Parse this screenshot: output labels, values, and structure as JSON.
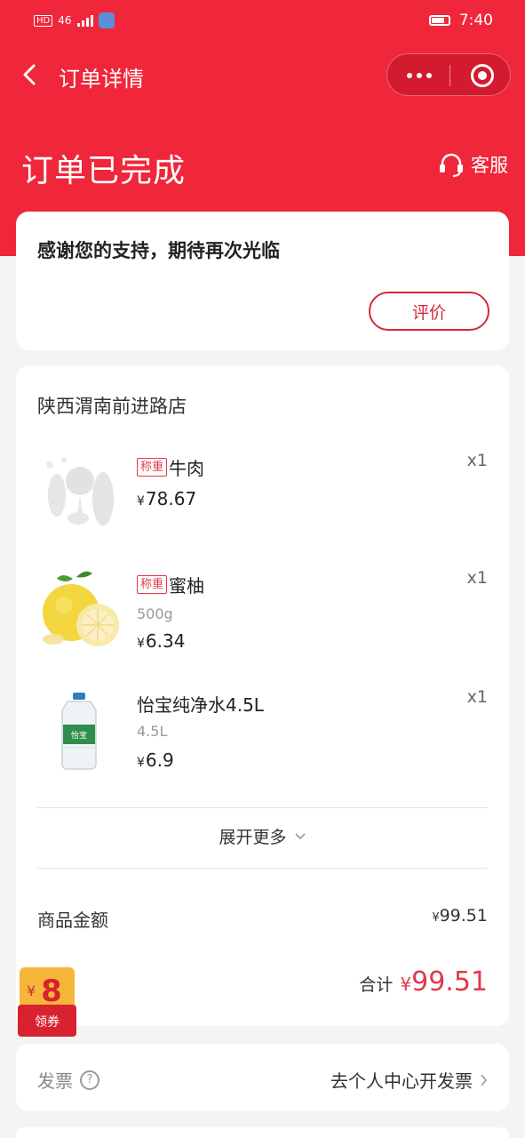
{
  "status_bar": {
    "time": "7:40",
    "network": "46",
    "battery_level": ""
  },
  "nav": {
    "title": "订单详情"
  },
  "order": {
    "status": "订单已完成",
    "service_label": "客服"
  },
  "thanks": {
    "message": "感谢您的支持，期待再次光临",
    "review_button": "评价"
  },
  "store": {
    "name": "陕西渭南前进路店"
  },
  "items": [
    {
      "tag": "称重",
      "name": "牛肉",
      "spec": "",
      "currency": "¥",
      "price": "78.67",
      "qty": "x1",
      "image": "placeholder-vegetable-illustration"
    },
    {
      "tag": "称重",
      "name": "蜜柚",
      "spec": "500g",
      "currency": "¥",
      "price": "6.34",
      "qty": "x1",
      "image": "pomelo"
    },
    {
      "tag": "",
      "name": "怡宝纯净水4.5L",
      "spec": "4.5L",
      "currency": "¥",
      "price": "6.9",
      "qty": "x1",
      "image": "water-bottle"
    }
  ],
  "expand_more": "展开更多",
  "summary": {
    "goods_amount_label": "商品金额",
    "currency": "¥",
    "goods_amount": "99.51",
    "total_label": "合计",
    "total": "99.51"
  },
  "coupon": {
    "amount": "8",
    "label": "领券"
  },
  "invoice": {
    "label": "发票",
    "help_icon": "?",
    "action": "去个人中心开发票"
  },
  "colors": {
    "brand_red": "#f0263a",
    "price_red": "#e0394a",
    "background": "#f4f4f4"
  }
}
